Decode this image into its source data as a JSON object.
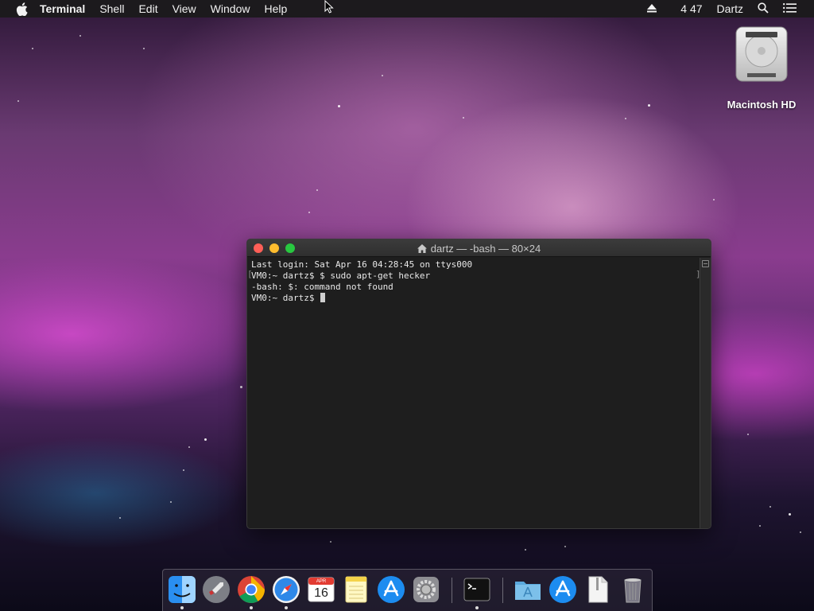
{
  "menubar": {
    "app_name": "Terminal",
    "menus": [
      "Shell",
      "Edit",
      "View",
      "Window",
      "Help"
    ],
    "clock": "4 47",
    "user": "Dartz"
  },
  "desktop": {
    "disk_label": "Macintosh HD"
  },
  "terminal": {
    "title": "dartz — -bash — 80×24",
    "lines": [
      "Last login: Sat Apr 16 04:28:45 on ttys000",
      "VM0:~ dartz$ $ sudo apt-get hecker",
      "-bash: $: command not found",
      "VM0:~ dartz$ "
    ]
  },
  "dock": {
    "calendar_month": "APR",
    "calendar_day": "16"
  },
  "colors": {
    "menubar_bg": "#1c1a1d",
    "terminal_bg": "#1e1e1e",
    "close": "#fe5f57",
    "minimize": "#febc2e",
    "zoom": "#28c840"
  }
}
